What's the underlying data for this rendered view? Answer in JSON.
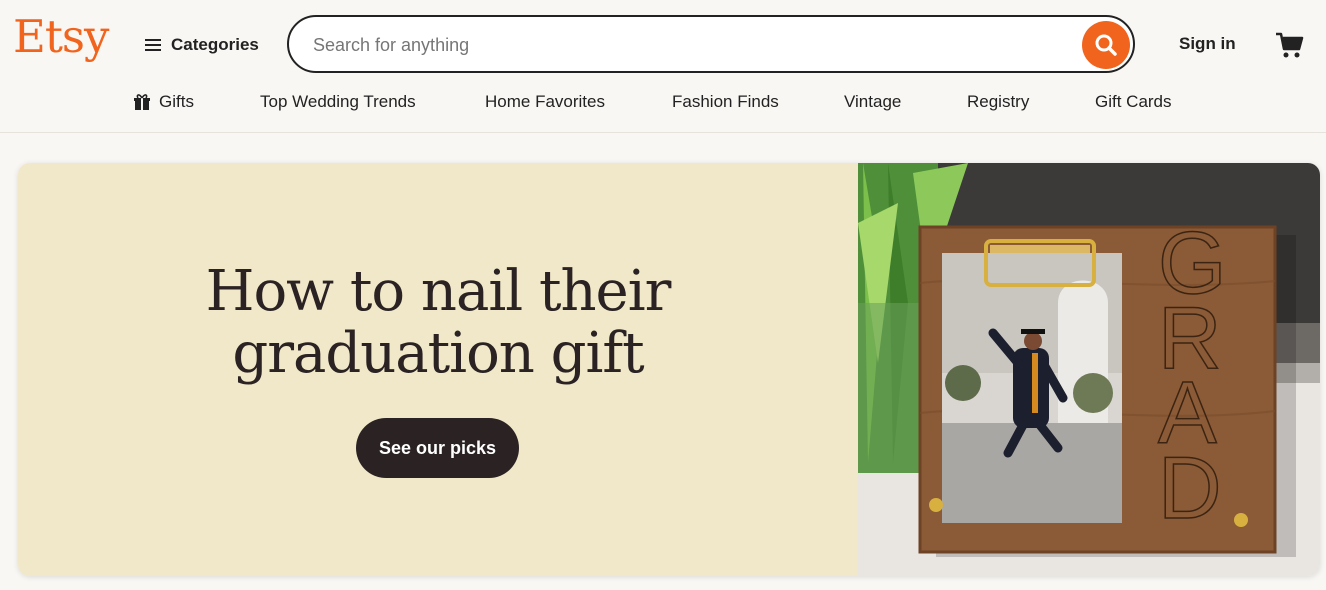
{
  "header": {
    "logo": "Etsy",
    "categories_label": "Categories",
    "search_placeholder": "Search for anything",
    "search_value": "",
    "signin_label": "Sign in",
    "icons": {
      "search": "search-icon",
      "cart": "cart-icon",
      "menu": "hamburger-icon",
      "gift": "gift-icon"
    }
  },
  "nav": {
    "items": [
      "Gifts",
      "Top Wedding Trends",
      "Home Favorites",
      "Fashion Finds",
      "Vintage",
      "Registry",
      "Gift Cards"
    ]
  },
  "hero": {
    "title_line1": "How to nail their",
    "title_line2": "graduation gift",
    "button_label": "See our picks",
    "frame_lettering": "GRAD"
  },
  "colors": {
    "brand_orange": "#f1641e",
    "hero_bg": "#f1e8c9",
    "hero_button": "#2b2323",
    "page_bg": "#f9f7f4"
  }
}
